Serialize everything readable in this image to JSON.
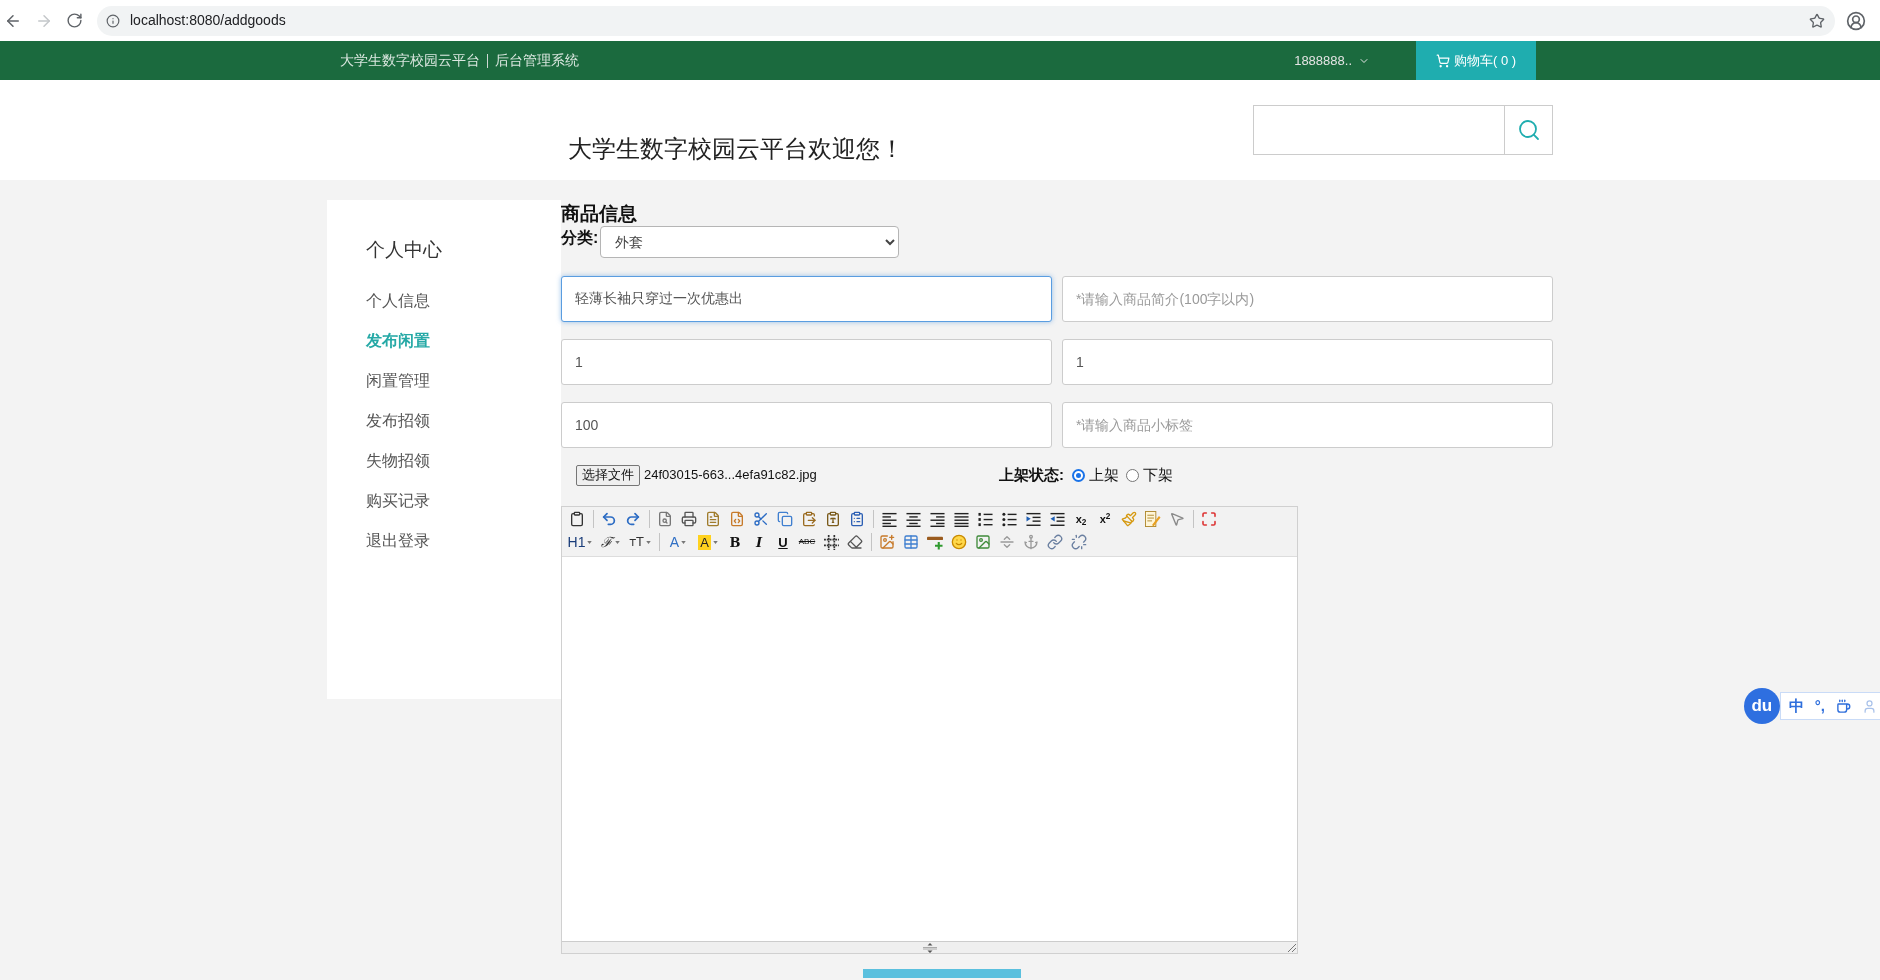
{
  "browser": {
    "url": "localhost:8080/addgoods",
    "forward": {
      "disabled": true
    }
  },
  "nav": {
    "brand": "大学生数字校园云平台",
    "system": "后台管理系统",
    "user": "1888888..",
    "cart": "购物车( 0 )"
  },
  "header": {
    "title": "大学生数字校园云平台欢迎您！"
  },
  "sidebar": {
    "title": "个人中心",
    "items": [
      {
        "label": "个人信息",
        "selected": false
      },
      {
        "label": "发布闲置",
        "selected": true
      },
      {
        "label": "闲置管理",
        "selected": false
      },
      {
        "label": "发布招领",
        "selected": false
      },
      {
        "label": "失物招领",
        "selected": false
      },
      {
        "label": "购买记录",
        "selected": false
      },
      {
        "label": "退出登录",
        "selected": false
      }
    ]
  },
  "form": {
    "title": "商品信息",
    "category": {
      "label": "分类:",
      "value": "外套"
    },
    "fields": [
      {
        "value": "轻薄长袖只穿过一次优惠出",
        "focused": true
      },
      {
        "placeholder": "*请输入商品简介(100字以内)",
        "focused": false
      },
      {
        "value": "1",
        "focused": false
      },
      {
        "value": "1",
        "focused": false
      },
      {
        "value": "100",
        "focused": false
      },
      {
        "placeholder": "*请输入商品小标签",
        "focused": false
      }
    ],
    "file": {
      "button": "选择文件",
      "filename": "24f03015-663...4efa91c82.jpg"
    },
    "status": {
      "label": "上架状态:",
      "options": [
        {
          "label": "上架",
          "selected": true
        },
        {
          "label": "下架",
          "selected": false
        }
      ]
    },
    "editor": {
      "toolbar_labels": [
        {
          "label": "x$_{2}$",
          "dropdown": false
        },
        {
          "label": "x$^{2}$",
          "dropdown": false
        },
        {
          "label": "H1",
          "dropdown": true
        },
        {
          "label": "ℱ",
          "dropdown": true
        },
        {
          "label": "ᴛT",
          "dropdown": true
        },
        {
          "label": "A",
          "dropdown": true
        },
        {
          "label": "A",
          "dropdown": true
        },
        {
          "label": "B",
          "dropdown": false
        },
        {
          "label": "I",
          "dropdown": false
        },
        {
          "label": "U",
          "dropdown": false
        },
        {
          "label": "ABC",
          "dropdown": false
        }
      ]
    }
  },
  "ime_toolbar": {
    "logo": "du",
    "mode": "中",
    "punctuation": "°,"
  }
}
